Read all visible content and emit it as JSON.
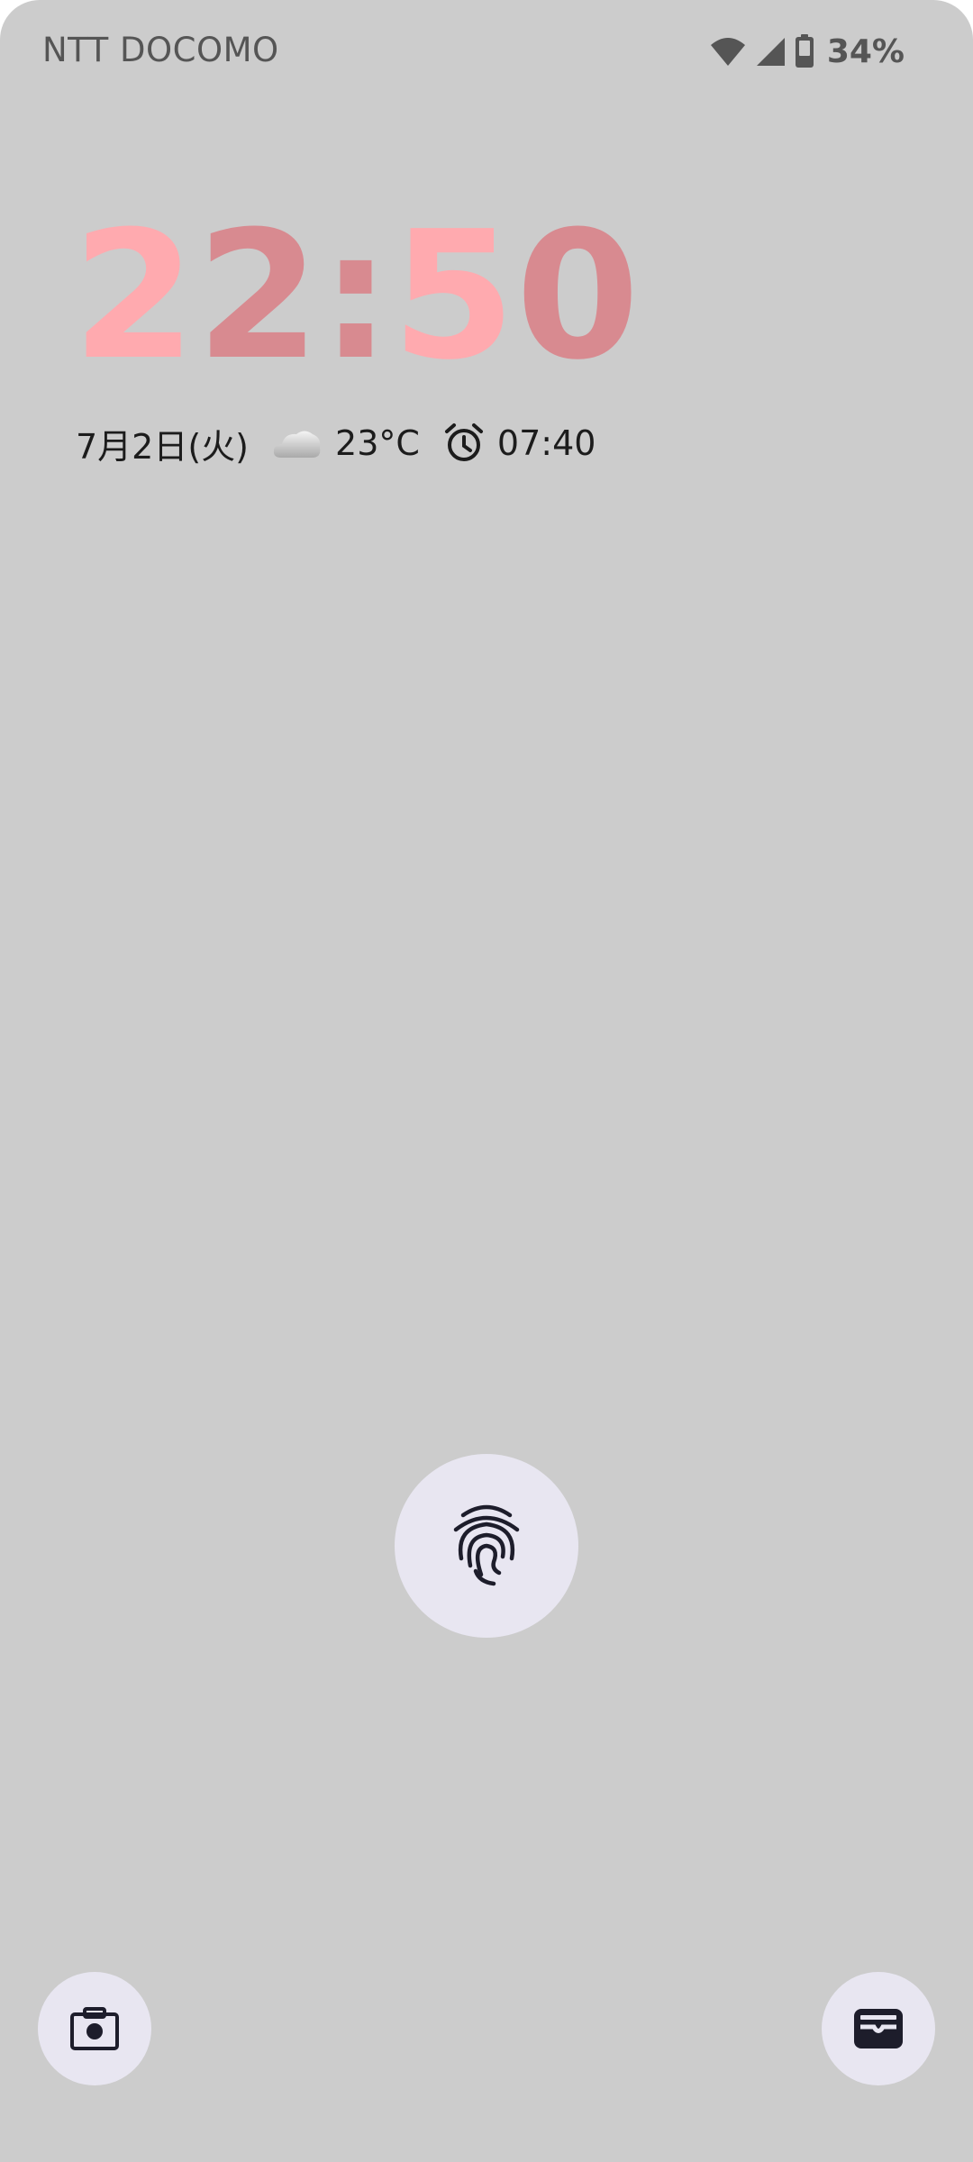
{
  "status_bar": {
    "carrier": "NTT DOCOMO",
    "battery_percent": "34%",
    "icons": [
      "wifi-icon",
      "cellular-signal-icon",
      "battery-icon"
    ]
  },
  "clock": {
    "time": "22:50",
    "colors": {
      "light": "#ffaaaf",
      "dark": "#d88a90"
    }
  },
  "info": {
    "date": "7月2日(火)",
    "weather_icon": "cloud-icon",
    "temperature": "23°C",
    "alarm_icon": "alarm-icon",
    "alarm_time": "07:40"
  },
  "lock": {
    "fingerprint_icon": "fingerprint-icon"
  },
  "shortcuts": {
    "left": "camera-icon",
    "right": "wallet-icon"
  },
  "colors": {
    "background": "#cccccc",
    "button": "#e8e6f1",
    "icon": "#1d1d2b"
  }
}
